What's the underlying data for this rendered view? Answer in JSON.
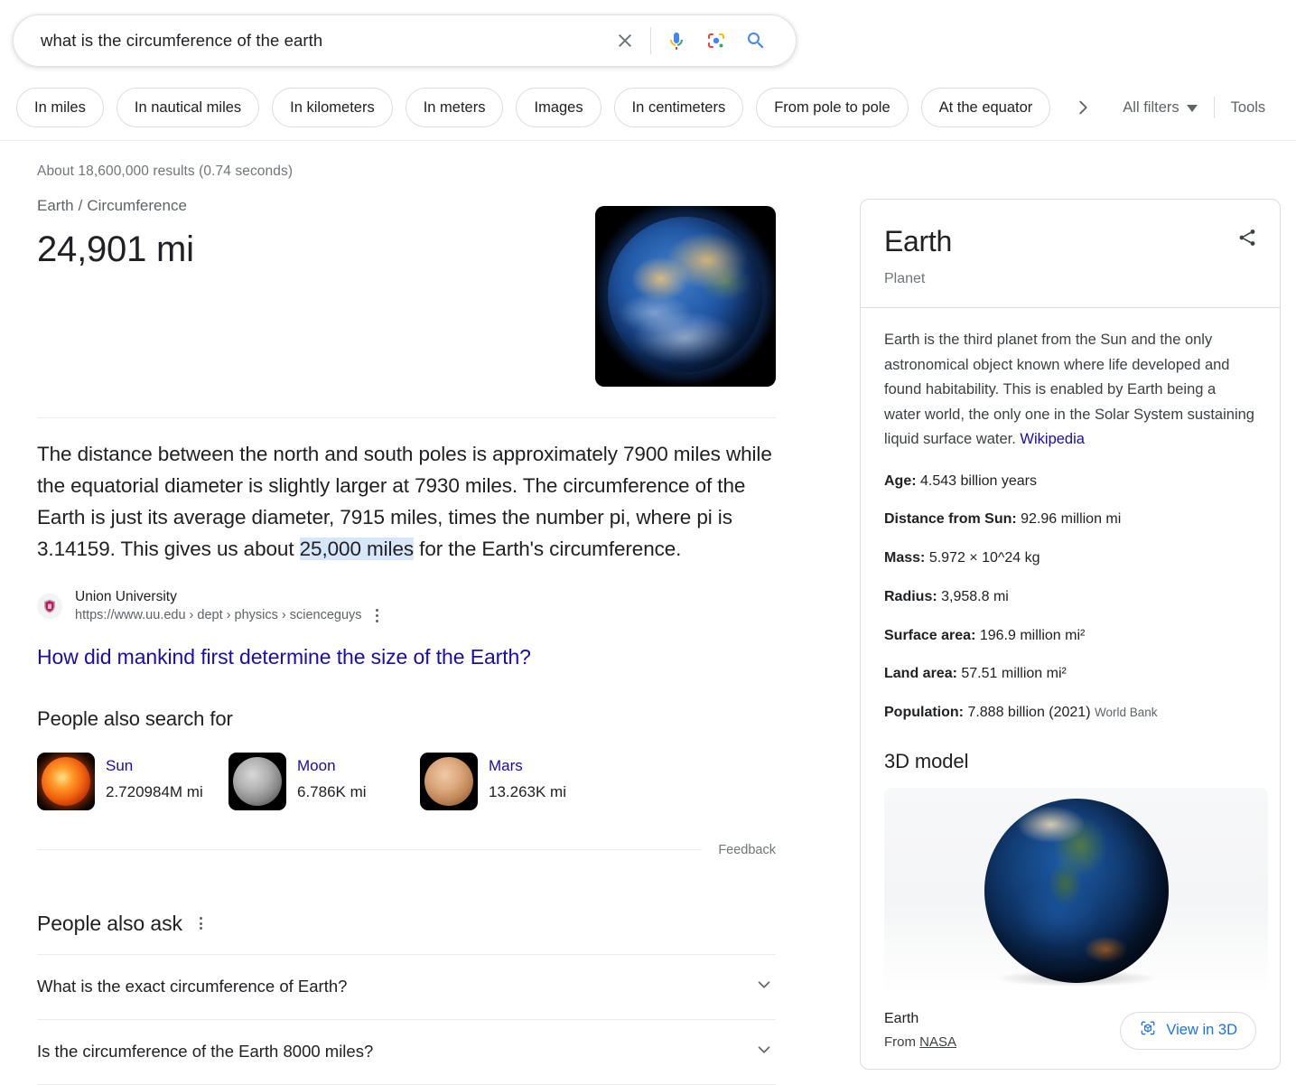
{
  "search": {
    "query": "what is the circumference of the earth",
    "placeholder": "Search",
    "clear_label": "Clear",
    "voice_label": "Search by voice",
    "lens_label": "Search by image",
    "submit_label": "Google Search"
  },
  "filters": {
    "chips": [
      "In miles",
      "In nautical miles",
      "In kilometers",
      "In meters",
      "Images",
      "In centimeters",
      "From pole to pole",
      "At the equator"
    ],
    "next_label": "Next",
    "all_filters": "All filters",
    "tools": "Tools"
  },
  "results": {
    "stats": "About 18,600,000 results (0.74 seconds)"
  },
  "featured": {
    "breadcrumb_root": "Earth",
    "breadcrumb_sep": "/",
    "breadcrumb_leaf": "Circumference",
    "answer": "24,901 mi",
    "thumb_alt": "Earth",
    "paragraph_part1": "The distance between the north and south poles is approximately 7900 miles while the equatorial diameter is slightly larger at 7930 miles. The circumference of the Earth is just its average diameter, 7915 miles, times the number pi, where pi is 3.14159. This gives us about ",
    "paragraph_highlight": "25,000 miles",
    "paragraph_part2": " for the Earth's circumference.",
    "source_name": "Union University",
    "source_url": "https://www.uu.edu › dept › physics › scienceguys",
    "more_options": "About this result",
    "link_title": "How did mankind first determine the size of the Earth?"
  },
  "people_also_search": {
    "title": "People also search for",
    "items": [
      {
        "name": "Sun",
        "value": "2.720984M mi",
        "orb": "orb-sun"
      },
      {
        "name": "Moon",
        "value": "6.786K mi",
        "orb": "orb-moon"
      },
      {
        "name": "Mars",
        "value": "13.263K mi",
        "orb": "orb-mars"
      }
    ],
    "feedback": "Feedback"
  },
  "people_also_ask": {
    "title": "People also ask",
    "more_options": "About this result",
    "questions": [
      "What is the exact circumference of Earth?",
      "Is the circumference of the Earth 8000 miles?"
    ]
  },
  "knowledge_panel": {
    "title": "Earth",
    "subtitle": "Planet",
    "share_label": "Share",
    "description": "Earth is the third planet from the Sun and the only astronomical object known where life developed and found habitability. This is enabled by Earth being a water world, the only one in the Solar System sustaining liquid surface water. ",
    "description_link": "Wikipedia",
    "facts": [
      {
        "label": "Age:",
        "value": "4.543 billion years",
        "source": ""
      },
      {
        "label": "Distance from Sun:",
        "value": "92.96 million mi",
        "source": ""
      },
      {
        "label": "Mass:",
        "value": "5.972 × 10^24 kg",
        "source": ""
      },
      {
        "label": "Radius:",
        "value": "3,958.8 mi",
        "source": ""
      },
      {
        "label": "Surface area:",
        "value": "196.9 million mi²",
        "source": ""
      },
      {
        "label": "Land area:",
        "value": "57.51 million mi²",
        "source": ""
      },
      {
        "label": "Population:",
        "value": "7.888 billion (2021)",
        "source": "World Bank"
      }
    ],
    "model_section_title": "3D model",
    "model_name": "Earth",
    "model_from_prefix": "From ",
    "model_from_source": "NASA",
    "view_3d_label": "View in 3D"
  },
  "colors": {
    "link_blue": "#1a0dab",
    "accent_blue": "#1a73e8",
    "text_primary": "#202124",
    "text_secondary": "#70757a",
    "highlight": "#d7e6f8"
  }
}
